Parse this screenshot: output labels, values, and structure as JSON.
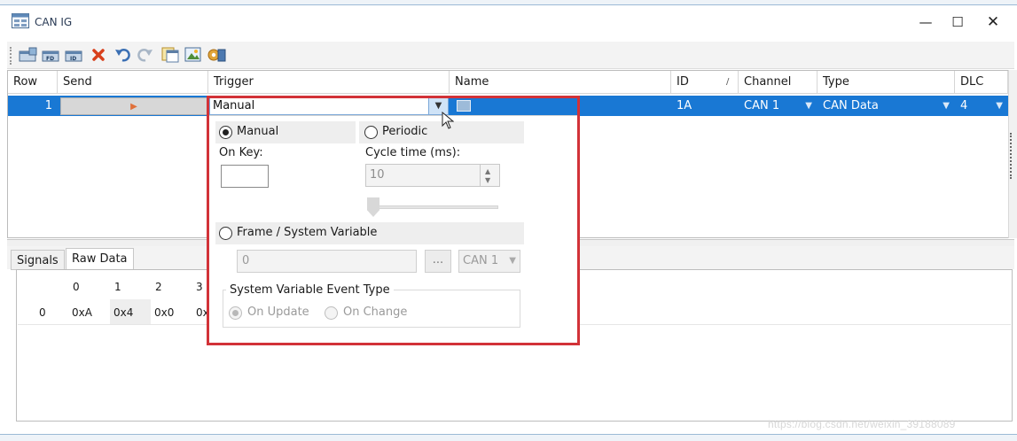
{
  "window": {
    "title": "CAN IG",
    "minimize": "—",
    "maximize": "☐",
    "close": "✕"
  },
  "toolbar": {
    "icons": [
      "add-frame-icon",
      "add-fd-frame-icon",
      "add-id-frame-icon",
      "delete-icon",
      "undo-icon",
      "redo-icon",
      "copy-icon",
      "image-icon",
      "settings-icon"
    ]
  },
  "grid": {
    "columns": [
      "Row",
      "Send",
      "Trigger",
      "Name",
      "ID",
      "Channel",
      "Type",
      "DLC"
    ],
    "id_sort_marker": "/",
    "rows": [
      {
        "row": "1",
        "trigger": "Manual",
        "name": "",
        "id": "1A",
        "channel": "CAN 1",
        "type": "CAN Data",
        "dlc": "4"
      }
    ]
  },
  "tabs": [
    "Signals",
    "Raw Data"
  ],
  "raw_data": {
    "headers": [
      "0",
      "1",
      "2",
      "3"
    ],
    "row_index": "0",
    "values": [
      "0xA",
      "0x4",
      "0x0",
      "0x"
    ]
  },
  "popup": {
    "manual_label": "Manual",
    "periodic_label": "Periodic",
    "on_key_label": "On Key:",
    "cycle_label": "Cycle time (ms):",
    "cycle_value": "10",
    "frame_label": "Frame / System Variable",
    "frame_value": "0",
    "ellipsis": "...",
    "channel": "CAN 1",
    "group_title": "System Variable Event Type",
    "on_update_label": "On Update",
    "on_change_label": "On Change",
    "selected_trigger": "manual",
    "selected_event": "on_update"
  },
  "watermark": "https://blog.csdn.net/weixin_39188089",
  "colors": {
    "selection": "#1978d4",
    "highlight_border": "#d23238"
  }
}
